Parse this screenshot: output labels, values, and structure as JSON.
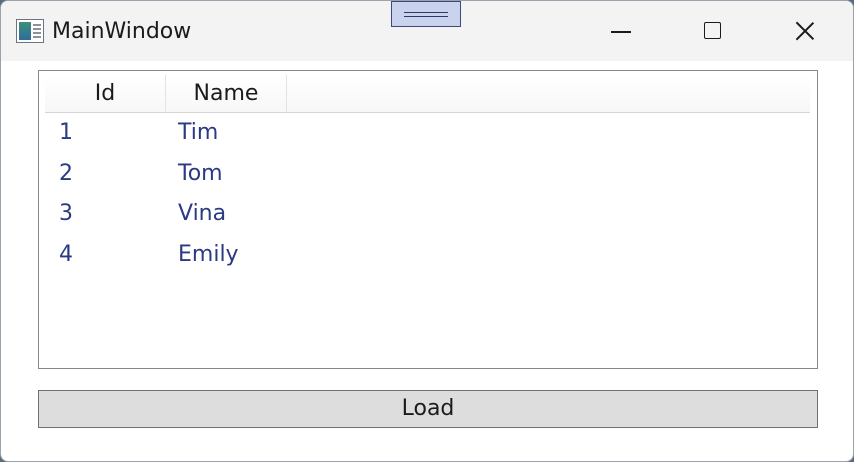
{
  "window": {
    "title": "MainWindow",
    "icons": {
      "app": "app-window-icon",
      "minimize": "minimize-icon",
      "maximize": "maximize-icon",
      "close": "close-icon"
    }
  },
  "listview": {
    "columns": [
      {
        "key": "id",
        "label": "Id"
      },
      {
        "key": "name",
        "label": "Name"
      }
    ],
    "rows": [
      {
        "id": "1",
        "name": "Tim"
      },
      {
        "id": "2",
        "name": "Tom"
      },
      {
        "id": "3",
        "name": "Vina"
      },
      {
        "id": "4",
        "name": "Emily"
      }
    ]
  },
  "load_button": {
    "label": "Load"
  },
  "colors": {
    "row_text": "#2b3a82",
    "titlebar": "#f3f3f3",
    "button_bg": "#dddddd"
  }
}
